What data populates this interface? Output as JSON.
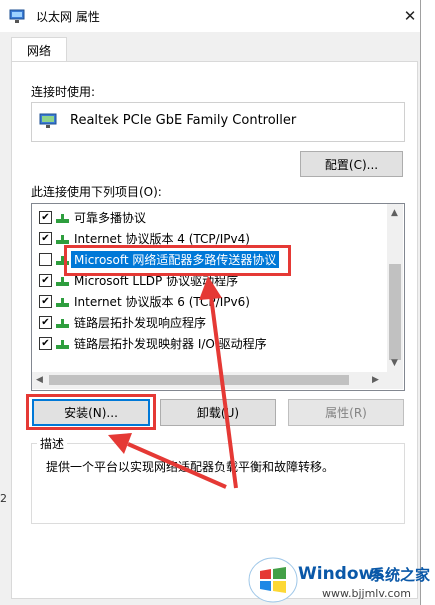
{
  "window": {
    "title": "以太网 属性",
    "close_glyph": "✕"
  },
  "tabs": [
    {
      "label": "网络",
      "active": true
    }
  ],
  "connect_using": {
    "label": "连接时使用:",
    "adapter_name": "Realtek PCIe GbE Family Controller",
    "configure_button": "配置(C)..."
  },
  "items_section": {
    "label": "此连接使用下列项目(O):",
    "items": [
      {
        "label": "可靠多播协议",
        "checked": true,
        "selected": false
      },
      {
        "label": "Internet 协议版本 4 (TCP/IPv4)",
        "checked": true,
        "selected": false
      },
      {
        "label": "Microsoft 网络适配器多路传送器协议",
        "checked": false,
        "selected": true
      },
      {
        "label": "Microsoft LLDP 协议驱动程序",
        "checked": true,
        "selected": false
      },
      {
        "label": "Internet 协议版本 6 (TCP/IPv6)",
        "checked": true,
        "selected": false
      },
      {
        "label": "链路层拓扑发现响应程序",
        "checked": true,
        "selected": false
      },
      {
        "label": "链路层拓扑发现映射器 I/O 驱动程序",
        "checked": true,
        "selected": false
      }
    ]
  },
  "buttons": {
    "install": "安装(N)...",
    "uninstall": "卸载(U)",
    "properties": "属性(R)"
  },
  "description": {
    "label": "描述",
    "text": "提供一个平台以实现网络适配器负载平衡和故障转移。"
  },
  "background": {
    "edge_digit": "2"
  },
  "watermark": {
    "brand": "Windows",
    "cn": "系统之家",
    "url": "www.bjjmlv.com"
  },
  "colors": {
    "selection": "#0078d7",
    "annotation_red": "#e53935",
    "protocol_icon": "#2e9e3e"
  }
}
